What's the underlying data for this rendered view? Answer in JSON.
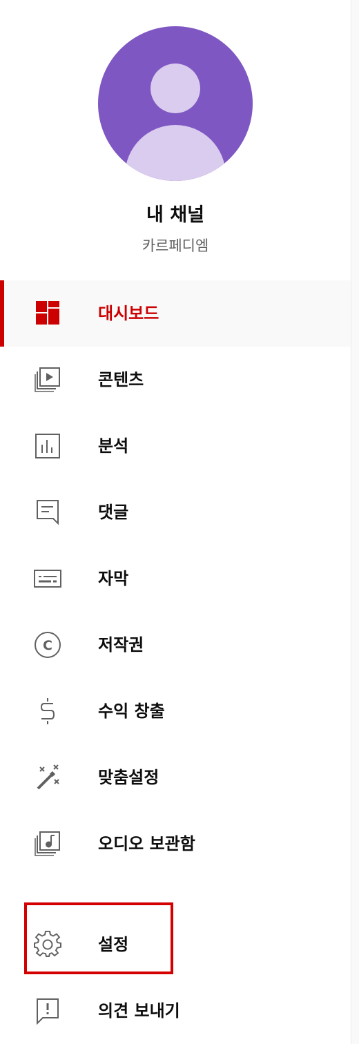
{
  "channel": {
    "title": "내 채널",
    "subtitle": "카르페디엠"
  },
  "colors": {
    "accent": "#cc0000",
    "avatar_bg": "#7e57c2",
    "avatar_fg": "#d9ccef",
    "icon_gray": "#606060",
    "highlight_box": "#d40000"
  },
  "menu": {
    "items": [
      {
        "label": "대시보드",
        "icon": "dashboard-icon",
        "active": true
      },
      {
        "label": "콘텐츠",
        "icon": "video-content-icon"
      },
      {
        "label": "분석",
        "icon": "analytics-icon"
      },
      {
        "label": "댓글",
        "icon": "comment-icon"
      },
      {
        "label": "자막",
        "icon": "subtitles-icon"
      },
      {
        "label": "저작권",
        "icon": "copyright-icon"
      },
      {
        "label": "수익 창출",
        "icon": "dollar-icon"
      },
      {
        "label": "맞춤설정",
        "icon": "magic-wand-icon"
      },
      {
        "label": "오디오 보관함",
        "icon": "audio-library-icon"
      },
      {
        "label": "설정",
        "icon": "gear-icon",
        "highlighted": true
      },
      {
        "label": "의견 보내기",
        "icon": "feedback-icon"
      }
    ]
  }
}
